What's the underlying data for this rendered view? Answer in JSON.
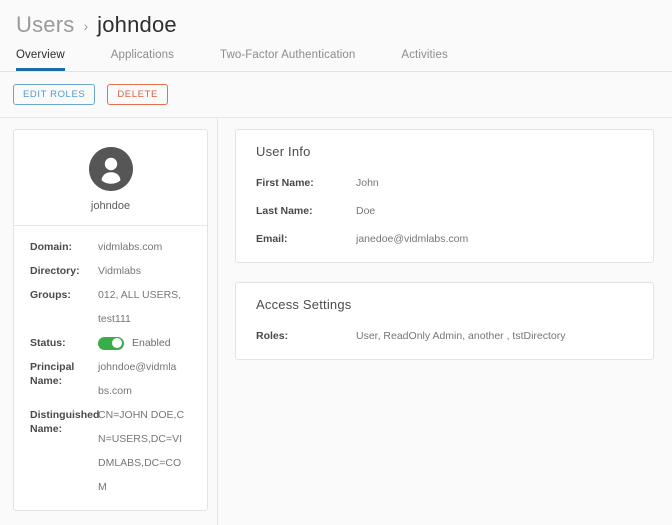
{
  "header": {
    "breadcrumb_parent": "Users",
    "breadcrumb_separator": "›",
    "breadcrumb_current": "johndoe"
  },
  "tabs": [
    {
      "label": "Overview",
      "active": true
    },
    {
      "label": "Applications",
      "active": false
    },
    {
      "label": "Two-Factor Authentication",
      "active": false
    },
    {
      "label": "Activities",
      "active": false
    }
  ],
  "actions": {
    "edit_roles_label": "EDIT ROLES",
    "delete_label": "DELETE"
  },
  "profile": {
    "avatar_icon": "user-avatar-icon",
    "username": "johndoe",
    "fields": [
      {
        "label": "Domain:",
        "value": "vidmlabs.com"
      },
      {
        "label": "Directory:",
        "value": "Vidmlabs"
      },
      {
        "label": "Groups:",
        "value_lines": [
          "012, ALL USERS,",
          "test111"
        ]
      },
      {
        "label": "Status:",
        "toggle": true,
        "toggle_on": true,
        "toggle_label": "Enabled"
      },
      {
        "label": "Principal Name:",
        "value_lines": [
          "johndoe@vidmla",
          "bs.com"
        ]
      },
      {
        "label": "Distinguished Name:",
        "value_lines": [
          "CN=JOHN DOE,C",
          "N=USERS,DC=VI",
          "DMLABS,DC=CO",
          "M"
        ]
      }
    ]
  },
  "user_info": {
    "title": "User Info",
    "rows": [
      {
        "label": "First Name:",
        "value": "John"
      },
      {
        "label": "Last Name:",
        "value": "Doe"
      },
      {
        "label": "Email:",
        "value": "janedoe@vidmlabs.com"
      }
    ]
  },
  "access_settings": {
    "title": "Access Settings",
    "rows": [
      {
        "label": "Roles:",
        "value": "User, ReadOnly Admin, another , tstDirectory"
      }
    ]
  },
  "colors": {
    "accent_blue": "#1b6ea3",
    "button_blue": "#4f9bca",
    "button_red": "#d4603f",
    "toggle_green": "#3aad4a",
    "page_bg": "#fafafa",
    "card_bg": "#ffffff",
    "border": "#e3e3e3"
  }
}
